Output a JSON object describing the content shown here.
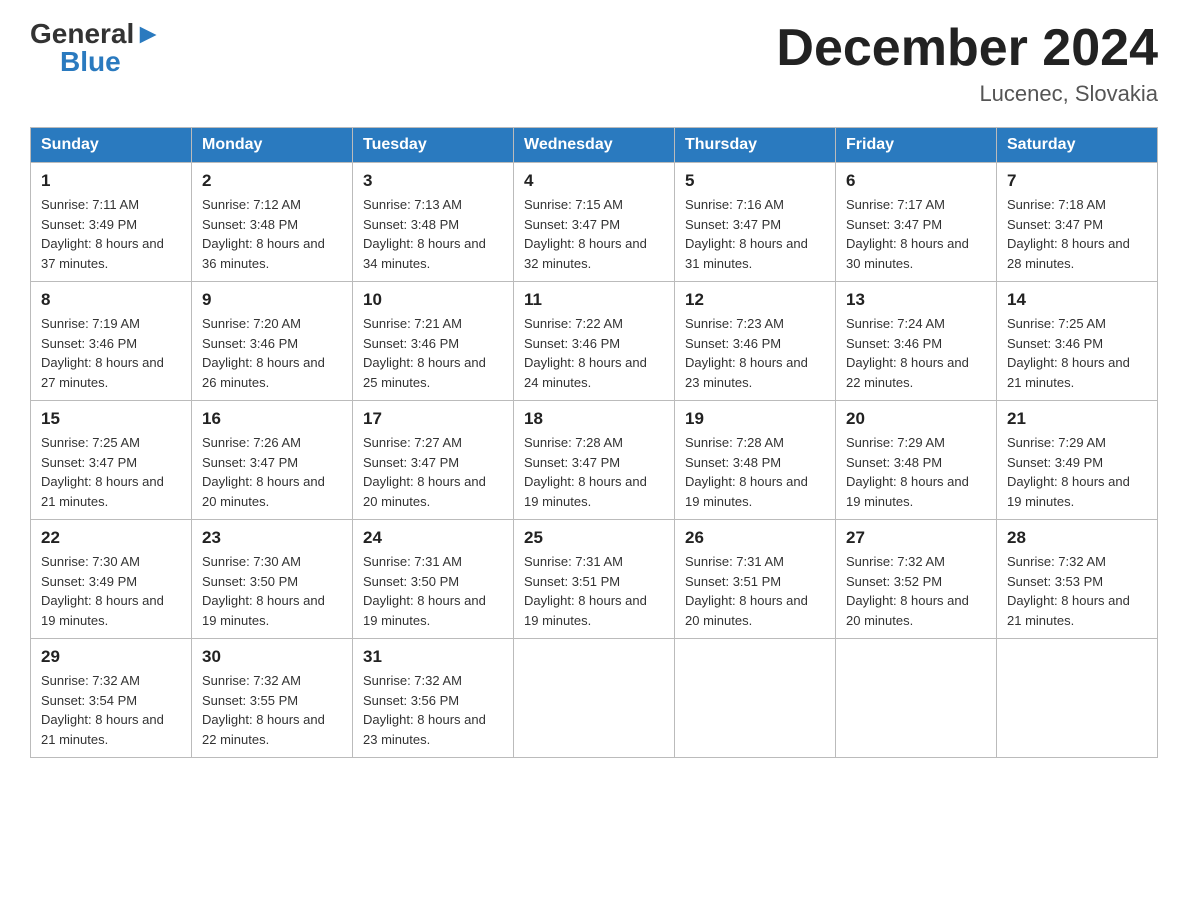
{
  "header": {
    "logo_general": "General",
    "logo_blue": "Blue",
    "month_title": "December 2024",
    "location": "Lucenec, Slovakia"
  },
  "days_of_week": [
    "Sunday",
    "Monday",
    "Tuesday",
    "Wednesday",
    "Thursday",
    "Friday",
    "Saturday"
  ],
  "weeks": [
    [
      {
        "day": "1",
        "sunrise": "7:11 AM",
        "sunset": "3:49 PM",
        "daylight": "8 hours and 37 minutes."
      },
      {
        "day": "2",
        "sunrise": "7:12 AM",
        "sunset": "3:48 PM",
        "daylight": "8 hours and 36 minutes."
      },
      {
        "day": "3",
        "sunrise": "7:13 AM",
        "sunset": "3:48 PM",
        "daylight": "8 hours and 34 minutes."
      },
      {
        "day": "4",
        "sunrise": "7:15 AM",
        "sunset": "3:47 PM",
        "daylight": "8 hours and 32 minutes."
      },
      {
        "day": "5",
        "sunrise": "7:16 AM",
        "sunset": "3:47 PM",
        "daylight": "8 hours and 31 minutes."
      },
      {
        "day": "6",
        "sunrise": "7:17 AM",
        "sunset": "3:47 PM",
        "daylight": "8 hours and 30 minutes."
      },
      {
        "day": "7",
        "sunrise": "7:18 AM",
        "sunset": "3:47 PM",
        "daylight": "8 hours and 28 minutes."
      }
    ],
    [
      {
        "day": "8",
        "sunrise": "7:19 AM",
        "sunset": "3:46 PM",
        "daylight": "8 hours and 27 minutes."
      },
      {
        "day": "9",
        "sunrise": "7:20 AM",
        "sunset": "3:46 PM",
        "daylight": "8 hours and 26 minutes."
      },
      {
        "day": "10",
        "sunrise": "7:21 AM",
        "sunset": "3:46 PM",
        "daylight": "8 hours and 25 minutes."
      },
      {
        "day": "11",
        "sunrise": "7:22 AM",
        "sunset": "3:46 PM",
        "daylight": "8 hours and 24 minutes."
      },
      {
        "day": "12",
        "sunrise": "7:23 AM",
        "sunset": "3:46 PM",
        "daylight": "8 hours and 23 minutes."
      },
      {
        "day": "13",
        "sunrise": "7:24 AM",
        "sunset": "3:46 PM",
        "daylight": "8 hours and 22 minutes."
      },
      {
        "day": "14",
        "sunrise": "7:25 AM",
        "sunset": "3:46 PM",
        "daylight": "8 hours and 21 minutes."
      }
    ],
    [
      {
        "day": "15",
        "sunrise": "7:25 AM",
        "sunset": "3:47 PM",
        "daylight": "8 hours and 21 minutes."
      },
      {
        "day": "16",
        "sunrise": "7:26 AM",
        "sunset": "3:47 PM",
        "daylight": "8 hours and 20 minutes."
      },
      {
        "day": "17",
        "sunrise": "7:27 AM",
        "sunset": "3:47 PM",
        "daylight": "8 hours and 20 minutes."
      },
      {
        "day": "18",
        "sunrise": "7:28 AM",
        "sunset": "3:47 PM",
        "daylight": "8 hours and 19 minutes."
      },
      {
        "day": "19",
        "sunrise": "7:28 AM",
        "sunset": "3:48 PM",
        "daylight": "8 hours and 19 minutes."
      },
      {
        "day": "20",
        "sunrise": "7:29 AM",
        "sunset": "3:48 PM",
        "daylight": "8 hours and 19 minutes."
      },
      {
        "day": "21",
        "sunrise": "7:29 AM",
        "sunset": "3:49 PM",
        "daylight": "8 hours and 19 minutes."
      }
    ],
    [
      {
        "day": "22",
        "sunrise": "7:30 AM",
        "sunset": "3:49 PM",
        "daylight": "8 hours and 19 minutes."
      },
      {
        "day": "23",
        "sunrise": "7:30 AM",
        "sunset": "3:50 PM",
        "daylight": "8 hours and 19 minutes."
      },
      {
        "day": "24",
        "sunrise": "7:31 AM",
        "sunset": "3:50 PM",
        "daylight": "8 hours and 19 minutes."
      },
      {
        "day": "25",
        "sunrise": "7:31 AM",
        "sunset": "3:51 PM",
        "daylight": "8 hours and 19 minutes."
      },
      {
        "day": "26",
        "sunrise": "7:31 AM",
        "sunset": "3:51 PM",
        "daylight": "8 hours and 20 minutes."
      },
      {
        "day": "27",
        "sunrise": "7:32 AM",
        "sunset": "3:52 PM",
        "daylight": "8 hours and 20 minutes."
      },
      {
        "day": "28",
        "sunrise": "7:32 AM",
        "sunset": "3:53 PM",
        "daylight": "8 hours and 21 minutes."
      }
    ],
    [
      {
        "day": "29",
        "sunrise": "7:32 AM",
        "sunset": "3:54 PM",
        "daylight": "8 hours and 21 minutes."
      },
      {
        "day": "30",
        "sunrise": "7:32 AM",
        "sunset": "3:55 PM",
        "daylight": "8 hours and 22 minutes."
      },
      {
        "day": "31",
        "sunrise": "7:32 AM",
        "sunset": "3:56 PM",
        "daylight": "8 hours and 23 minutes."
      },
      null,
      null,
      null,
      null
    ]
  ],
  "labels": {
    "sunrise_prefix": "Sunrise: ",
    "sunset_prefix": "Sunset: ",
    "daylight_prefix": "Daylight: "
  }
}
